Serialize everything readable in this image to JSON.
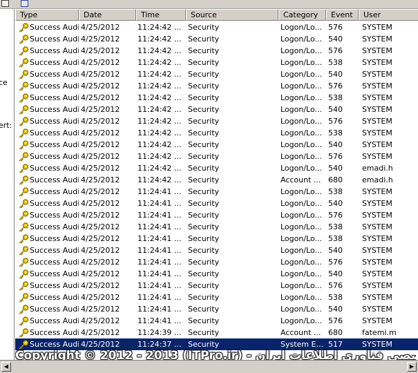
{
  "columns": {
    "type": "Type",
    "date": "Date",
    "time": "Time",
    "source": "Source",
    "category": "Category",
    "event": "Event",
    "user": "User"
  },
  "left_pane": {
    "fragments": [
      "ce",
      "ert:"
    ]
  },
  "rows": [
    {
      "type": "Success Audit",
      "date": "4/25/2012",
      "time": "11:24:42 ...",
      "source": "Security",
      "category": "Logon/Lo...",
      "event": "576",
      "user": "SYSTEM"
    },
    {
      "type": "Success Audit",
      "date": "4/25/2012",
      "time": "11:24:42 ...",
      "source": "Security",
      "category": "Logon/Lo...",
      "event": "540",
      "user": "SYSTEM"
    },
    {
      "type": "Success Audit",
      "date": "4/25/2012",
      "time": "11:24:42 ...",
      "source": "Security",
      "category": "Logon/Lo...",
      "event": "576",
      "user": "SYSTEM"
    },
    {
      "type": "Success Audit",
      "date": "4/25/2012",
      "time": "11:24:42 ...",
      "source": "Security",
      "category": "Logon/Lo...",
      "event": "538",
      "user": "SYSTEM"
    },
    {
      "type": "Success Audit",
      "date": "4/25/2012",
      "time": "11:24:42 ...",
      "source": "Security",
      "category": "Logon/Lo...",
      "event": "540",
      "user": "SYSTEM"
    },
    {
      "type": "Success Audit",
      "date": "4/25/2012",
      "time": "11:24:42 ...",
      "source": "Security",
      "category": "Logon/Lo...",
      "event": "576",
      "user": "SYSTEM"
    },
    {
      "type": "Success Audit",
      "date": "4/25/2012",
      "time": "11:24:42 ...",
      "source": "Security",
      "category": "Logon/Lo...",
      "event": "538",
      "user": "SYSTEM"
    },
    {
      "type": "Success Audit",
      "date": "4/25/2012",
      "time": "11:24:42 ...",
      "source": "Security",
      "category": "Logon/Lo...",
      "event": "540",
      "user": "SYSTEM"
    },
    {
      "type": "Success Audit",
      "date": "4/25/2012",
      "time": "11:24:42 ...",
      "source": "Security",
      "category": "Logon/Lo...",
      "event": "576",
      "user": "SYSTEM"
    },
    {
      "type": "Success Audit",
      "date": "4/25/2012",
      "time": "11:24:42 ...",
      "source": "Security",
      "category": "Logon/Lo...",
      "event": "538",
      "user": "SYSTEM"
    },
    {
      "type": "Success Audit",
      "date": "4/25/2012",
      "time": "11:24:42 ...",
      "source": "Security",
      "category": "Logon/Lo...",
      "event": "540",
      "user": "SYSTEM"
    },
    {
      "type": "Success Audit",
      "date": "4/25/2012",
      "time": "11:24:42 ...",
      "source": "Security",
      "category": "Logon/Lo...",
      "event": "576",
      "user": "SYSTEM"
    },
    {
      "type": "Success Audit",
      "date": "4/25/2012",
      "time": "11:24:42 ...",
      "source": "Security",
      "category": "Logon/Lo...",
      "event": "540",
      "user": "emadi.h"
    },
    {
      "type": "Success Audit",
      "date": "4/25/2012",
      "time": "11:24:42 ...",
      "source": "Security",
      "category": "Account ...",
      "event": "680",
      "user": "emadi.h"
    },
    {
      "type": "Success Audit",
      "date": "4/25/2012",
      "time": "11:24:41 ...",
      "source": "Security",
      "category": "Logon/Lo...",
      "event": "538",
      "user": "SYSTEM"
    },
    {
      "type": "Success Audit",
      "date": "4/25/2012",
      "time": "11:24:41 ...",
      "source": "Security",
      "category": "Logon/Lo...",
      "event": "540",
      "user": "SYSTEM"
    },
    {
      "type": "Success Audit",
      "date": "4/25/2012",
      "time": "11:24:41 ...",
      "source": "Security",
      "category": "Logon/Lo...",
      "event": "576",
      "user": "SYSTEM"
    },
    {
      "type": "Success Audit",
      "date": "4/25/2012",
      "time": "11:24:41 ...",
      "source": "Security",
      "category": "Logon/Lo...",
      "event": "538",
      "user": "SYSTEM"
    },
    {
      "type": "Success Audit",
      "date": "4/25/2012",
      "time": "11:24:41 ...",
      "source": "Security",
      "category": "Logon/Lo...",
      "event": "538",
      "user": "SYSTEM"
    },
    {
      "type": "Success Audit",
      "date": "4/25/2012",
      "time": "11:24:41 ...",
      "source": "Security",
      "category": "Logon/Lo...",
      "event": "540",
      "user": "SYSTEM"
    },
    {
      "type": "Success Audit",
      "date": "4/25/2012",
      "time": "11:24:41 ...",
      "source": "Security",
      "category": "Logon/Lo...",
      "event": "576",
      "user": "SYSTEM"
    },
    {
      "type": "Success Audit",
      "date": "4/25/2012",
      "time": "11:24:41 ...",
      "source": "Security",
      "category": "Logon/Lo...",
      "event": "540",
      "user": "SYSTEM"
    },
    {
      "type": "Success Audit",
      "date": "4/25/2012",
      "time": "11:24:41 ...",
      "source": "Security",
      "category": "Logon/Lo...",
      "event": "576",
      "user": "SYSTEM"
    },
    {
      "type": "Success Audit",
      "date": "4/25/2012",
      "time": "11:24:41 ...",
      "source": "Security",
      "category": "Logon/Lo...",
      "event": "538",
      "user": "SYSTEM"
    },
    {
      "type": "Success Audit",
      "date": "4/25/2012",
      "time": "11:24:41 ...",
      "source": "Security",
      "category": "Logon/Lo...",
      "event": "540",
      "user": "SYSTEM"
    },
    {
      "type": "Success Audit",
      "date": "4/25/2012",
      "time": "11:24:41 ...",
      "source": "Security",
      "category": "Logon/Lo...",
      "event": "576",
      "user": "SYSTEM"
    },
    {
      "type": "Success Audit",
      "date": "4/25/2012",
      "time": "11:24:39 ...",
      "source": "Security",
      "category": "Account ...",
      "event": "680",
      "user": "fatemi.m"
    },
    {
      "type": "Success Audit",
      "date": "4/25/2012",
      "time": "11:24:37 ...",
      "source": "Security",
      "category": "System E...",
      "event": "517",
      "user": "SYSTEM",
      "selected": true
    }
  ],
  "watermark": "Copyright © 2012 - 2013 (ITPro.ir) - انجمن تخصصی فناوری اطلاعات ایران",
  "colors": {
    "selection": "#0a246a",
    "header": "#d4d0c8",
    "key_icon": "#c8a800"
  }
}
